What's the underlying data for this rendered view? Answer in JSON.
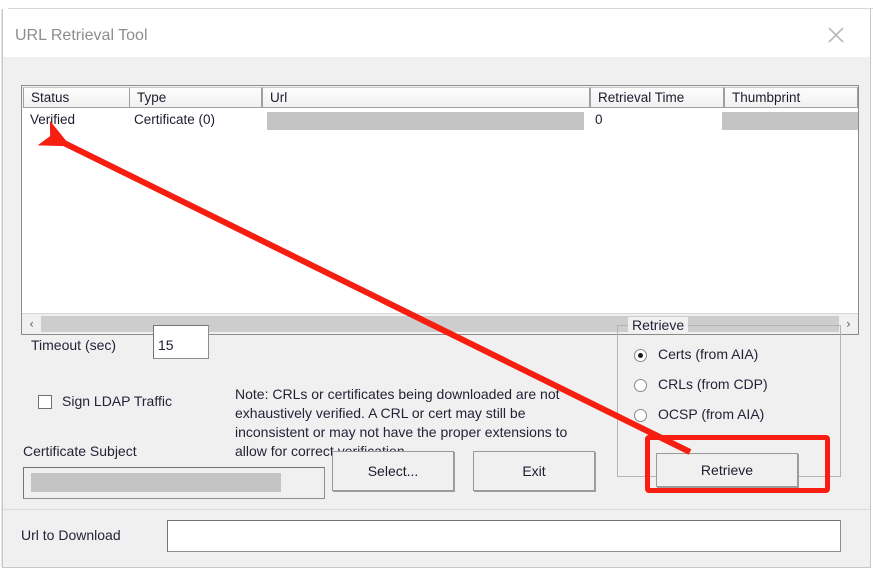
{
  "window": {
    "title": "URL Retrieval Tool",
    "close_icon": "close-icon",
    "background_sliver_text": "· ··· ···"
  },
  "listview": {
    "columns": [
      {
        "label": "Status"
      },
      {
        "label": "Type"
      },
      {
        "label": "Url"
      },
      {
        "label": "Retrieval Time"
      },
      {
        "label": "Thumbprint"
      }
    ],
    "rows": [
      {
        "status": "Verified",
        "type": "Certificate (0)",
        "url": "",
        "url_redacted": true,
        "retrieval_time": "0",
        "thumbprint": "",
        "thumbprint_redacted": true
      }
    ],
    "scrollbar": {
      "left_arrow": "‹",
      "right_arrow": "›"
    }
  },
  "controls": {
    "timeout_label": "Timeout (sec)",
    "timeout_value": "15",
    "timeout_placeholder": "",
    "sign_ldap_label": "Sign LDAP Traffic",
    "sign_ldap_checked": false,
    "certificate_subject_label": "Certificate Subject",
    "certificate_subject_value": "",
    "certificate_subject_redacted": true,
    "note_text": "Note: CRLs or certificates being downloaded are not exhaustively verified.  A CRL or cert may still be inconsistent or may not have the proper extensions to allow for correct verification."
  },
  "retrieve_group": {
    "title": "Retrieve",
    "options": [
      {
        "label": "Certs (from AIA)",
        "selected": true
      },
      {
        "label": "CRLs (from CDP)",
        "selected": false
      },
      {
        "label": "OCSP (from AIA)",
        "selected": false
      }
    ]
  },
  "buttons": {
    "select": "Select...",
    "exit": "Exit",
    "retrieve": "Retrieve"
  },
  "url_bar": {
    "label": "Url to Download",
    "value": "",
    "placeholder": ""
  },
  "annotations": {
    "highlight_color": "#fb1d12",
    "arrow_color": "#f61e10",
    "arrow_from": "retrieve-button",
    "arrow_to": "status-cell-verified"
  }
}
